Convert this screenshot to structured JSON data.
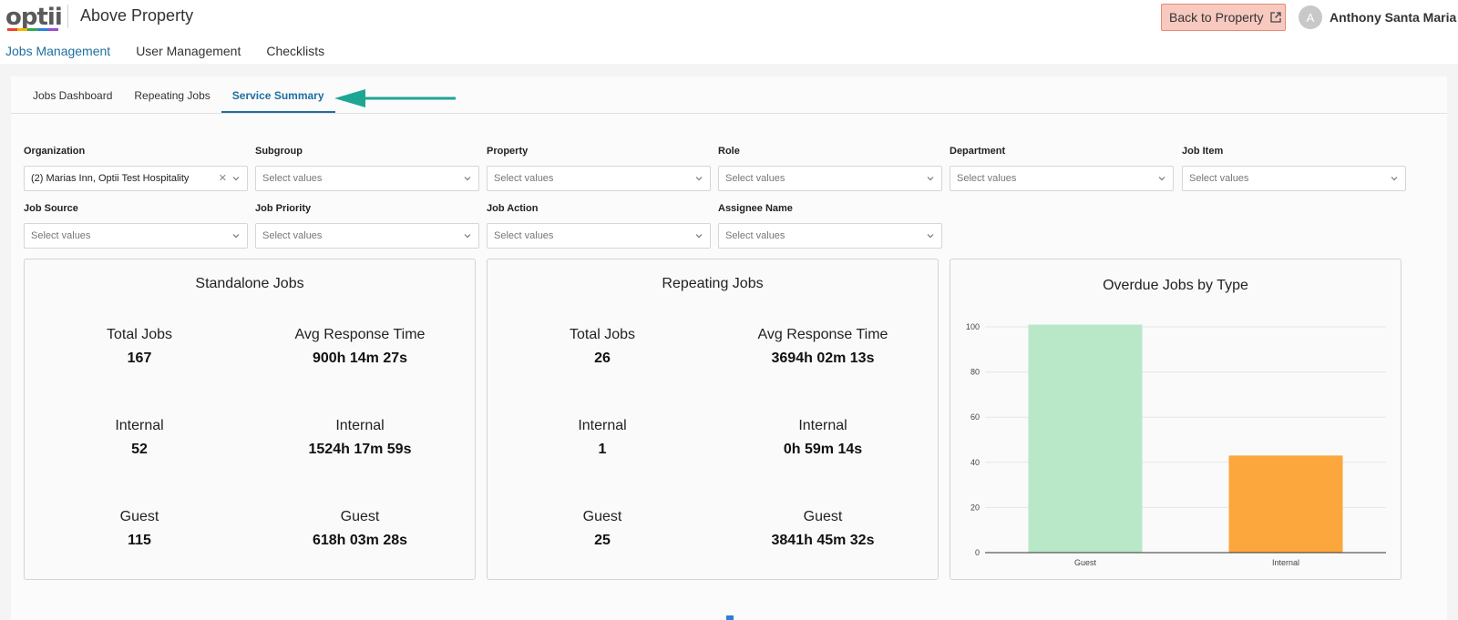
{
  "header": {
    "logo_text": "optii",
    "app_title": "Above Property",
    "back_label": "Back to Property",
    "avatar_initial": "A",
    "user_name": "Anthony Santa Maria"
  },
  "nav": [
    {
      "label": "Jobs Management",
      "active": true
    },
    {
      "label": "User Management",
      "active": false
    },
    {
      "label": "Checklists",
      "active": false
    }
  ],
  "subtabs": [
    {
      "label": "Jobs Dashboard",
      "active": false
    },
    {
      "label": "Repeating Jobs",
      "active": false
    },
    {
      "label": "Service Summary",
      "active": true
    }
  ],
  "filters": [
    {
      "label": "Organization",
      "value": "(2) Marias Inn, Optii Test Hospitality",
      "placeholder": ""
    },
    {
      "label": "Subgroup",
      "value": "",
      "placeholder": "Select values"
    },
    {
      "label": "Property",
      "value": "",
      "placeholder": "Select values"
    },
    {
      "label": "Role",
      "value": "",
      "placeholder": "Select values"
    },
    {
      "label": "Department",
      "value": "",
      "placeholder": "Select values"
    },
    {
      "label": "Job Item",
      "value": "",
      "placeholder": "Select values"
    },
    {
      "label": "Job Source",
      "value": "",
      "placeholder": "Select values"
    },
    {
      "label": "Job Priority",
      "value": "",
      "placeholder": "Select values"
    },
    {
      "label": "Job Action",
      "value": "",
      "placeholder": "Select values"
    },
    {
      "label": "Assignee Name",
      "value": "",
      "placeholder": "Select values"
    }
  ],
  "standalone": {
    "title": "Standalone Jobs",
    "total_label": "Total Jobs",
    "total_value": "167",
    "avg_label": "Avg Response Time",
    "avg_value": "900h 14m 27s",
    "internal_label": "Internal",
    "internal_value": "52",
    "internal_time_label": "Internal",
    "internal_time_value": "1524h 17m 59s",
    "guest_label": "Guest",
    "guest_value": "115",
    "guest_time_label": "Guest",
    "guest_time_value": "618h 03m 28s"
  },
  "repeating": {
    "title": "Repeating Jobs",
    "total_label": "Total Jobs",
    "total_value": "26",
    "avg_label": "Avg Response Time",
    "avg_value": "3694h 02m 13s",
    "internal_label": "Internal",
    "internal_value": "1",
    "internal_time_label": "Internal",
    "internal_time_value": "0h 59m 14s",
    "guest_label": "Guest",
    "guest_value": "25",
    "guest_time_label": "Guest",
    "guest_time_value": "3841h 45m 32s"
  },
  "chart_data": {
    "type": "bar",
    "title": "Overdue Jobs by Type",
    "categories": [
      "Guest",
      "Internal"
    ],
    "values": [
      101,
      43
    ],
    "colors": [
      "#b8e8c8",
      "#fca63e"
    ],
    "ylim": [
      0,
      100
    ],
    "yticks": [
      0,
      20,
      40,
      60,
      80,
      100
    ],
    "grid": true,
    "xlabel": "",
    "ylabel": ""
  },
  "colors": {
    "accent": "#1d6fa0",
    "annotation_arrow": "#1fa594",
    "back_button_bg": "#f7c9bf"
  }
}
